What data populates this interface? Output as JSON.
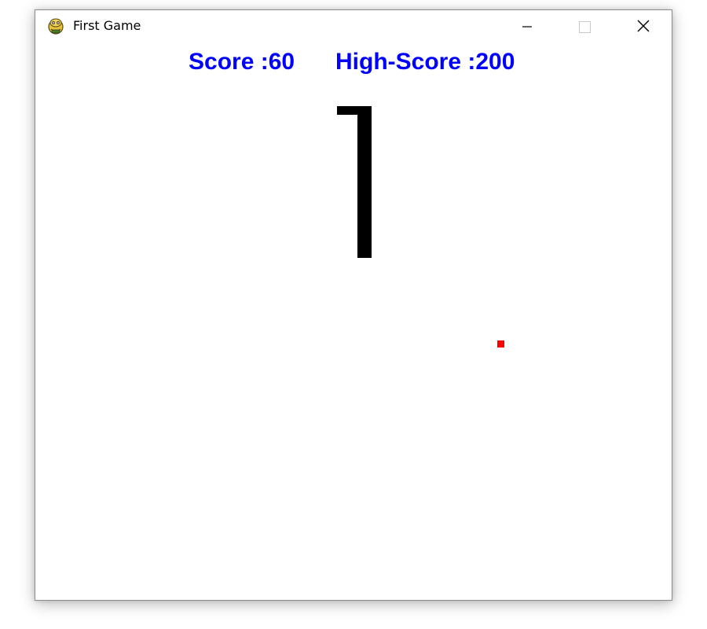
{
  "window": {
    "title": "First Game",
    "icon": "pygame-snake-icon",
    "controls": [
      "minimize-icon",
      "maximize-icon",
      "close-icon"
    ]
  },
  "hud": {
    "score_text": "Score :60",
    "high_score_text": "High-Score :200",
    "text_color": "#0000ff"
  },
  "game": {
    "background_color": "#ffffff",
    "snake_color": "#000000",
    "food_color": "#ff0000"
  }
}
